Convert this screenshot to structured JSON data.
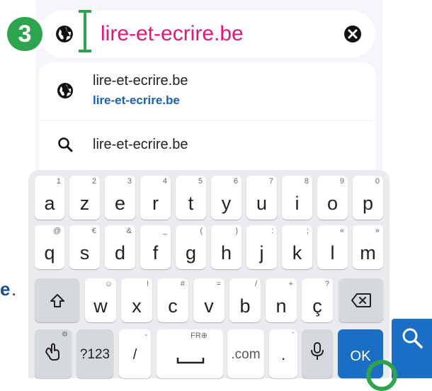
{
  "step_badge": "3",
  "address_bar": {
    "url": "lire-et-ecrire.be"
  },
  "suggestions": [
    {
      "title": "lire-et-ecrire.be",
      "subtitle": "lire-et-ecrire.be",
      "icon": "globe-icon"
    },
    {
      "title": "lire-et-ecrire.be",
      "icon": "search-icon"
    }
  ],
  "background_text": {
    "letter": "e",
    "punct": "."
  },
  "keyboard": {
    "row1": [
      {
        "k": "a",
        "h": "1"
      },
      {
        "k": "z",
        "h": "2"
      },
      {
        "k": "e",
        "h": "3"
      },
      {
        "k": "r",
        "h": "4"
      },
      {
        "k": "t",
        "h": "5"
      },
      {
        "k": "y",
        "h": "6"
      },
      {
        "k": "u",
        "h": "7"
      },
      {
        "k": "i",
        "h": "8"
      },
      {
        "k": "o",
        "h": "9"
      },
      {
        "k": "p",
        "h": "0"
      }
    ],
    "row2": [
      {
        "k": "q",
        "h": "@"
      },
      {
        "k": "s",
        "h": "€"
      },
      {
        "k": "d",
        "h": "&"
      },
      {
        "k": "f",
        "h": "_"
      },
      {
        "k": "g",
        "h": "("
      },
      {
        "k": "h",
        "h": ")"
      },
      {
        "k": "j",
        "h": ":"
      },
      {
        "k": "k",
        "h": ";"
      },
      {
        "k": "l",
        "h": "«"
      },
      {
        "k": "m",
        "h": "»"
      }
    ],
    "row3": [
      {
        "k": "w",
        "h": "☺"
      },
      {
        "k": "x",
        "h": "!"
      },
      {
        "k": "c",
        "h": "#"
      },
      {
        "k": "v",
        "h": "="
      },
      {
        "k": "b",
        "h": "/"
      },
      {
        "k": "n",
        "h": "+"
      },
      {
        "k": "ç",
        "h": "?"
      }
    ],
    "symbols_label": "?123",
    "slash_label": "/",
    "slash_hint": "-",
    "space_hint": "FR⊕",
    "dotcom_label": ".com",
    "period_label": ".",
    "period_hint": "'",
    "ok_label": "OK"
  },
  "colors": {
    "url_text": "#e5157a",
    "accent_green": "#2fa44f",
    "key_blue": "#1a6ec4",
    "link_blue": "#1a5fb4"
  }
}
